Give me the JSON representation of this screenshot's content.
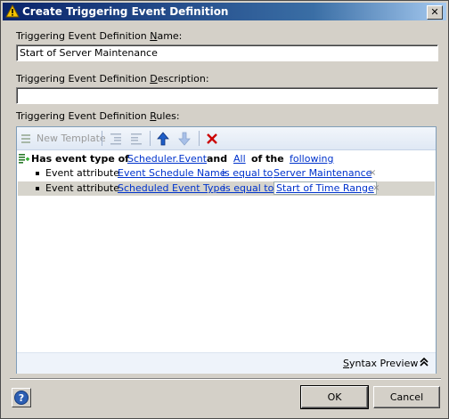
{
  "window": {
    "title": "Create Triggering Event Definition",
    "close_label": "✕"
  },
  "name_field": {
    "label_pre": "Triggering Event Definition ",
    "label_key": "N",
    "label_post": "ame:",
    "value": "Start of Server Maintenance"
  },
  "description_field": {
    "label_pre": "Triggering Event Definition ",
    "label_key": "D",
    "label_post": "escription:",
    "value": ""
  },
  "rules_field": {
    "label_pre": "Triggering Event Definition ",
    "label_key": "R",
    "label_post": "ules:"
  },
  "toolbar": {
    "new_template_label": "New Template"
  },
  "rule_header": {
    "prefix": "Has event type of",
    "event_type": "Scheduler.Event",
    "and": "and",
    "quantifier": "All",
    "of_the": "of the",
    "following": "following"
  },
  "conditions": [
    {
      "label": "Event attribute",
      "attribute": "Event Schedule Name",
      "operator": "is equal to",
      "value": "Server Maintenance",
      "remove": "×"
    },
    {
      "label": "Event attribute",
      "attribute": "Scheduled Event Type",
      "operator": "is equal to",
      "value": "Start of Time Range",
      "remove": "×"
    }
  ],
  "syntax_preview": {
    "label_pre": "",
    "label_key": "S",
    "label_post": "yntax Preview",
    "chevron": "≈"
  },
  "buttons": {
    "ok": "OK",
    "cancel": "Cancel"
  },
  "colors": {
    "link": "#0033cc",
    "title_start": "#0a246a",
    "title_end": "#a6caf0",
    "delete_red": "#cc0000",
    "arrow_blue": "#1f5fc8"
  }
}
